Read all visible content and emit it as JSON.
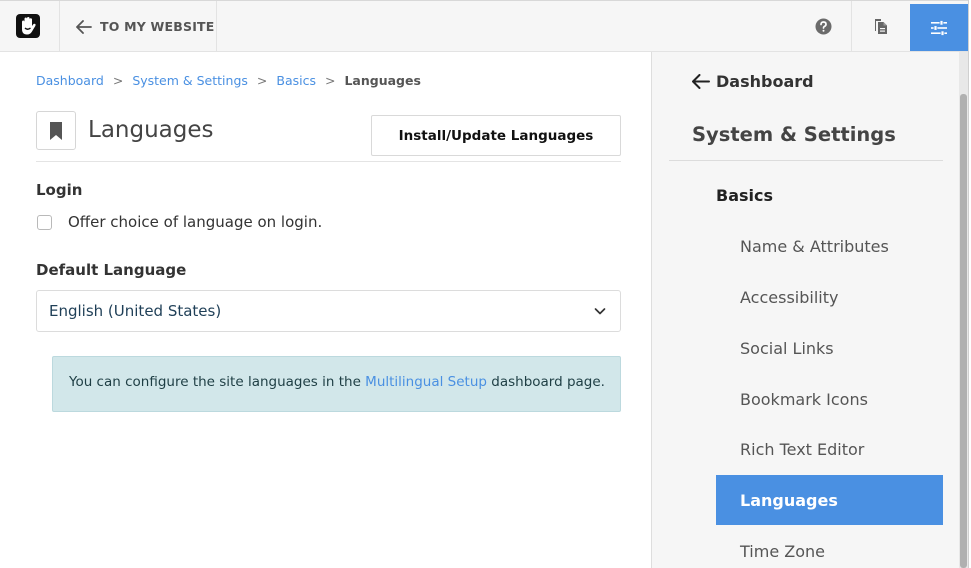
{
  "topbar": {
    "logo_icon": "concrete-hand-logo-icon",
    "back_icon": "arrow-left-icon",
    "back_label": "TO MY WEBSITE",
    "help_icon": "help-circle-icon",
    "pages_icon": "pages-icon",
    "settings_icon": "sliders-icon",
    "accent_color": "#4a90e2"
  },
  "breadcrumb": {
    "items": [
      "Dashboard",
      "System & Settings",
      "Basics"
    ],
    "separator": ">",
    "current": "Languages"
  },
  "header": {
    "title": "Languages",
    "icon": "bookmark-icon",
    "install_button": "Install/Update Languages"
  },
  "login": {
    "section_label": "Login",
    "checkbox_label": "Offer choice of language on login.",
    "checked": false
  },
  "default_language": {
    "section_label": "Default Language",
    "selected": "English (United States)",
    "chevron_icon": "chevron-down-icon"
  },
  "alert": {
    "text_before": "You can configure the site languages in the ",
    "link": "Multilingual Setup",
    "text_after": " dashboard page."
  },
  "panel": {
    "back_label": "Dashboard",
    "title": "System & Settings",
    "group": "Basics",
    "items": [
      {
        "label": "Name & Attributes",
        "active": false
      },
      {
        "label": "Accessibility",
        "active": false
      },
      {
        "label": "Social Links",
        "active": false
      },
      {
        "label": "Bookmark Icons",
        "active": false
      },
      {
        "label": "Rich Text Editor",
        "active": false
      },
      {
        "label": "Languages",
        "active": true
      },
      {
        "label": "Time Zone",
        "active": false
      }
    ]
  }
}
